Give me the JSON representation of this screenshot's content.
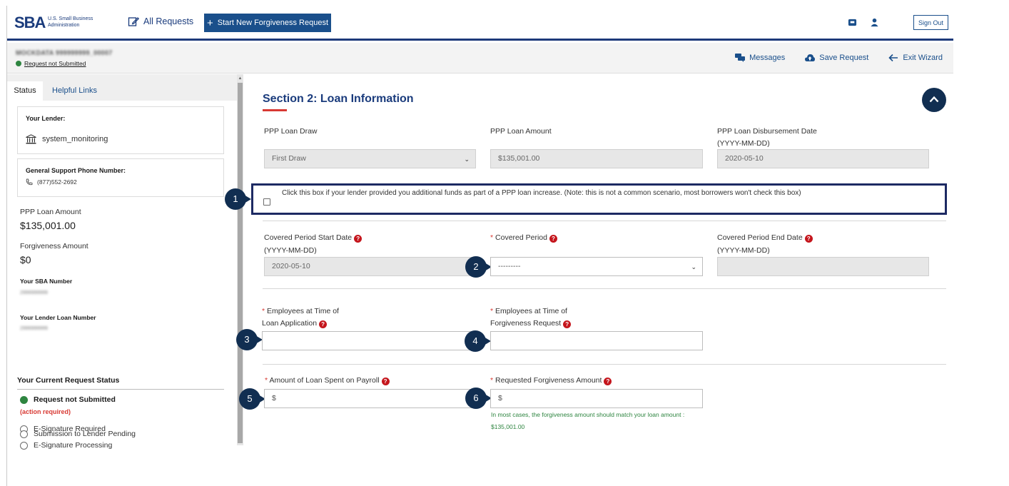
{
  "header": {
    "logo_text": "SBA",
    "logo_subtitle": "U.S. Small Business Administration",
    "all_requests_label": "All Requests",
    "start_new_label": "Start New Forgiveness Request",
    "sign_out_label": "Sign Out"
  },
  "subheader": {
    "request_id": "MOCKDATA 999999999_00007",
    "status_text": "Request not Submitted",
    "messages_label": "Messages",
    "save_label": "Save Request",
    "exit_label": "Exit Wizard"
  },
  "sidebar": {
    "tab_status": "Status",
    "tab_links": "Helpful Links",
    "lender_heading": "Your Lender:",
    "lender_name": "system_monitoring",
    "phone_heading": "General Support Phone Number:",
    "phone_number": "(877)552-2692",
    "loan_amount_label": "PPP Loan Amount",
    "loan_amount_value": "$135,001.00",
    "forgiveness_label": "Forgiveness Amount",
    "forgiveness_value": "$0",
    "sba_number_label": "Your SBA Number",
    "sba_number_value": "2999999999",
    "lender_loan_label": "Your Lender Loan Number",
    "lender_loan_value": "2999999999",
    "status_heading": "Your Current Request Status",
    "statuses": {
      "s0": "Request not Submitted",
      "s0_note": "(action required)",
      "s1": "E-Signature Required",
      "s2": "E-Signature Processing",
      "s3": "Submission to Lender Pending"
    }
  },
  "section": {
    "title": "Section 2: Loan Information",
    "draw_label": "PPP Loan Draw",
    "draw_value": "First Draw",
    "amount_label": "PPP Loan Amount",
    "amount_value": "$135,001.00",
    "disb_label": "PPP Loan Disbursement Date",
    "disb_format": "(YYYY-MM-DD)",
    "disb_value": "2020-05-10",
    "increase_text": "Click this box if your lender provided you additional funds as part of a PPP loan increase. (Note: this is not a common scenario, most borrowers won't check this box)",
    "cp_start_label": "Covered Period Start Date",
    "cp_start_format": "(YYYY-MM-DD)",
    "cp_start_value": "2020-05-10",
    "cp_label": "Covered Period",
    "cp_value": "---------",
    "cp_end_label": "Covered Period End Date",
    "cp_end_format": "(YYYY-MM-DD)",
    "emp_app_label_1": "Employees at Time of",
    "emp_app_label_2": "Loan Application",
    "emp_fr_label_1": "Employees at Time of",
    "emp_fr_label_2": "Forgiveness Request",
    "payroll_label": "Amount of Loan Spent on Payroll",
    "payroll_prefix": "$",
    "requested_label": "Requested Forgiveness Amount",
    "requested_prefix": "$",
    "hint_line_1": "In most cases, the forgiveness amount should match your loan amount :",
    "hint_line_2": "$135,001.00",
    "required_mark": "*",
    "help_mark": "?"
  },
  "callouts": {
    "c1": "1",
    "c2": "2",
    "c3": "3",
    "c4": "4",
    "c5": "5",
    "c6": "6"
  },
  "colors": {
    "primary": "#1a4f8b",
    "navy": "#112e51",
    "required": "#d83933",
    "success": "#2e8540"
  }
}
